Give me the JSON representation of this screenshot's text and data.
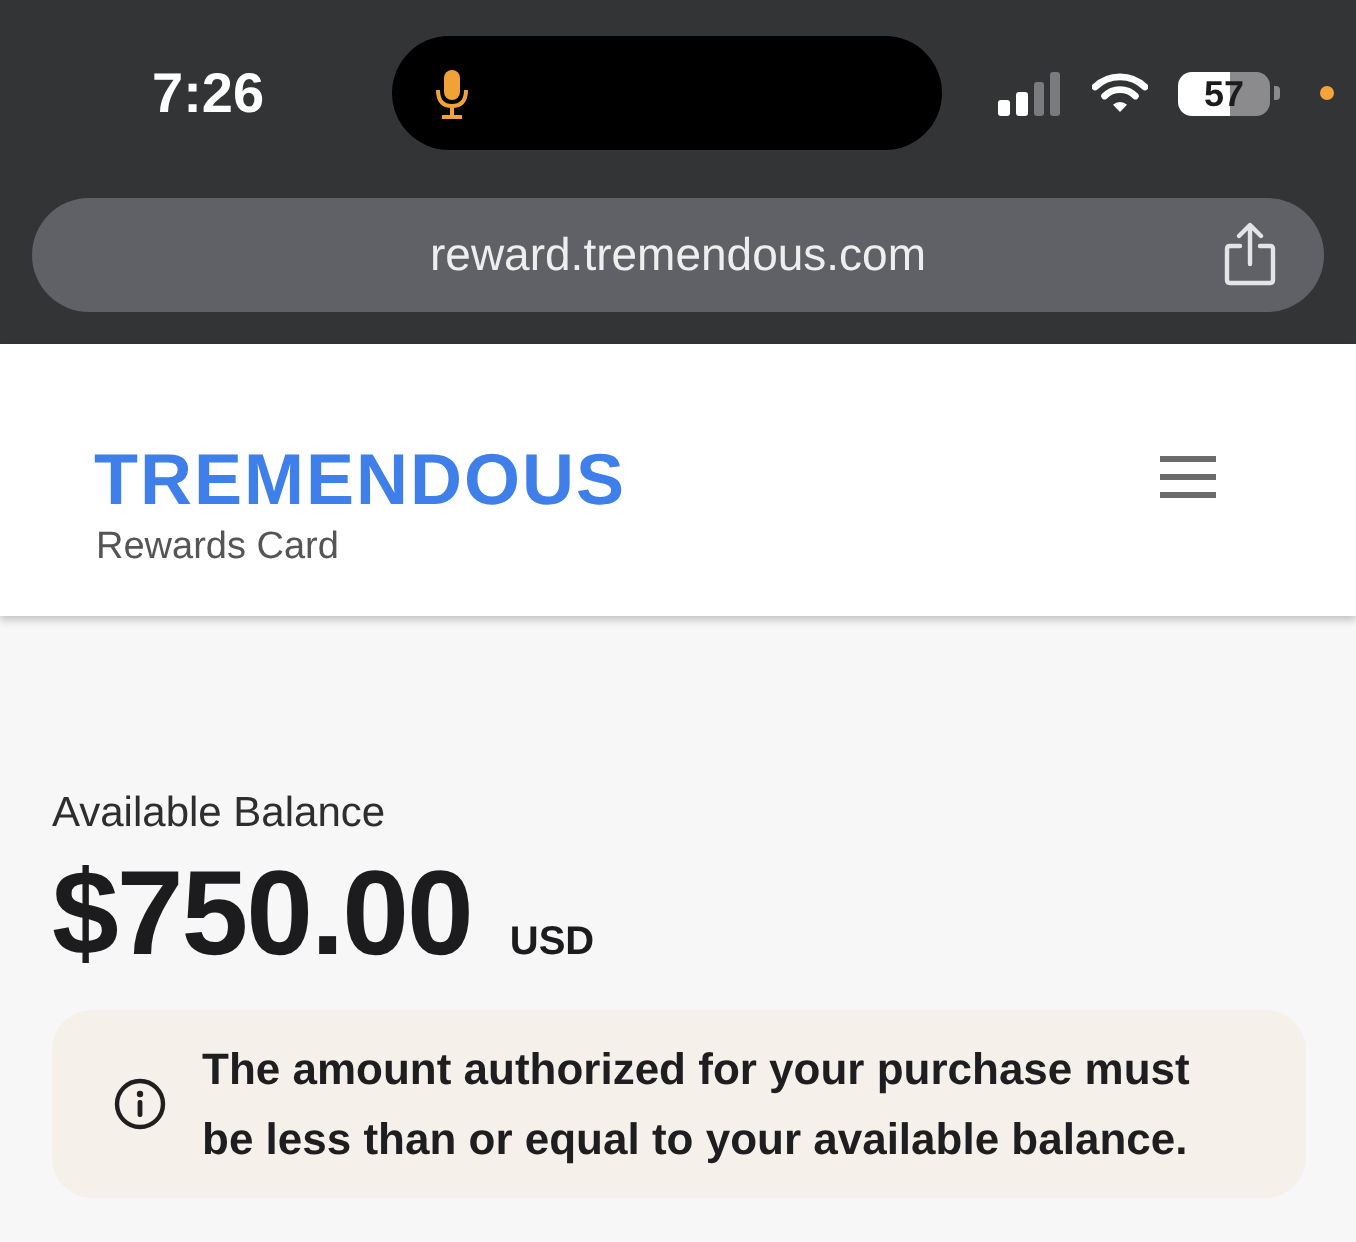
{
  "status_bar": {
    "time": "7:26",
    "battery": "57"
  },
  "browser": {
    "url": "reward.tremendous.com"
  },
  "header": {
    "logo": "TREMENDOUS",
    "subtitle": "Rewards Card"
  },
  "balance": {
    "label": "Available Balance",
    "amount": "$750.00",
    "currency": "USD"
  },
  "notice": {
    "text": "The amount authorized for your purchase must be less than or equal to your available balance."
  }
}
